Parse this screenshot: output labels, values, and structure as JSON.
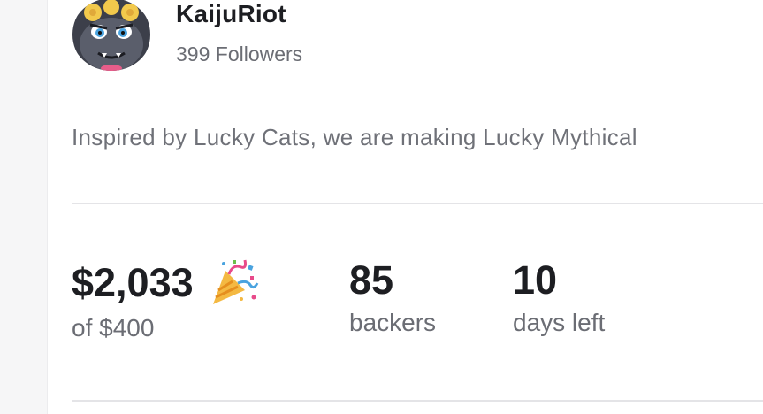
{
  "creator": {
    "name": "KaijuRiot",
    "followers": "399 Followers",
    "avatar_icon": "kaiju-avatar-icon"
  },
  "description": "Inspired by Lucky Cats, we are making Lucky Mythical",
  "stats": {
    "pledged": {
      "value": "$2,033",
      "label": "of $400",
      "icon": "party-popper-icon"
    },
    "backers": {
      "value": "85",
      "label": "backers"
    },
    "days_left": {
      "value": "10",
      "label": "days left"
    }
  },
  "colors": {
    "heading": "#1d1e22",
    "muted": "#6b6d74",
    "divider": "#e4e4e7",
    "gutter": "#f6f6f7"
  }
}
